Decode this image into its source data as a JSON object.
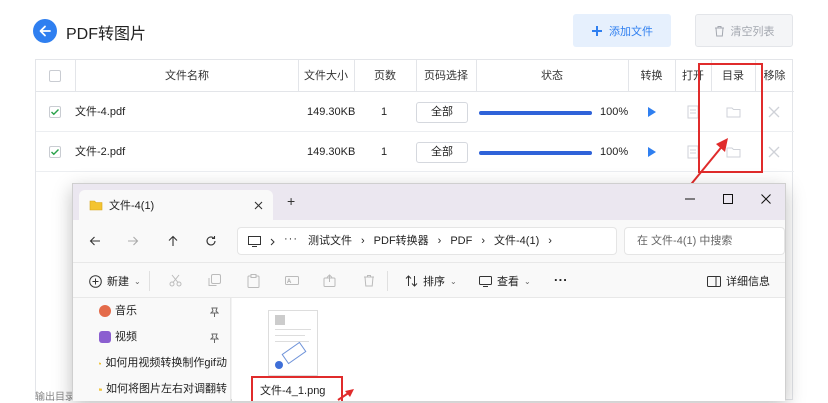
{
  "app": {
    "title": "PDF转图片",
    "add_file_label": "添加文件",
    "clear_list_label": "清空列表",
    "accent": "#2f7ff0"
  },
  "table": {
    "headers": {
      "name": "文件名称",
      "size": "文件大小",
      "pages": "页数",
      "page_select": "页码选择",
      "status": "状态",
      "convert": "转换",
      "open": "打开",
      "folder": "目录",
      "remove": "移除"
    },
    "rows": [
      {
        "name": "文件-4.pdf",
        "size": "149.30KB",
        "pages": "1",
        "page_select": "全部",
        "progress": "100%",
        "progress_value": 100
      },
      {
        "name": "文件-2.pdf",
        "size": "149.30KB",
        "pages": "1",
        "page_select": "全部",
        "progress": "100%",
        "progress_value": 100
      }
    ],
    "footer_partial": "输出目录"
  },
  "explorer": {
    "tab_title": "文件-4(1)",
    "new_tab": "+",
    "breadcrumb": [
      "测试文件",
      "PDF转换器",
      "PDF",
      "文件-4(1)"
    ],
    "search_placeholder": "在 文件-4(1) 中搜索",
    "commands": {
      "new": "新建",
      "sort": "排序",
      "view": "查看",
      "more": "...",
      "details": "详细信息"
    },
    "sidebar": [
      {
        "label": "音乐",
        "icon": "music-icon",
        "pinned": true
      },
      {
        "label": "视频",
        "icon": "video-icon",
        "pinned": true
      },
      {
        "label": "如何用视频转换制作gif动",
        "icon": "folder-icon"
      },
      {
        "label": "如何将图片左右对调翻转",
        "icon": "folder-icon"
      }
    ],
    "file": {
      "name": "文件-4_1.png"
    }
  },
  "colors": {
    "highlight_red": "#e02b2b",
    "progress_blue": "#2f63d9"
  }
}
